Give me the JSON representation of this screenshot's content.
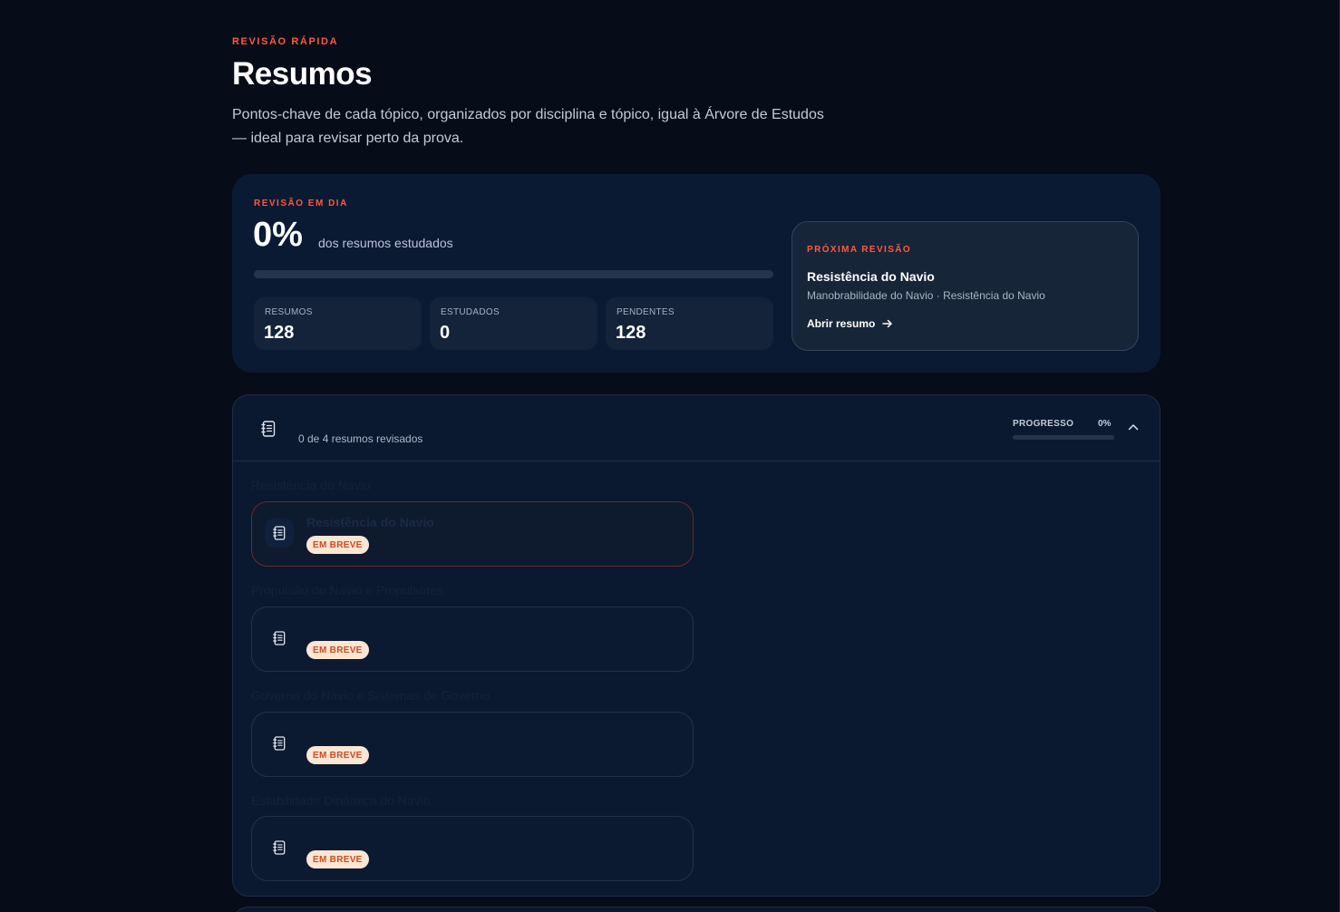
{
  "header": {
    "eyebrow": "REVISÃO RÁPIDA",
    "title": "Resumos",
    "description": "Pontos-chave de cada tópico, organizados por disciplina e tópico, igual à Árvore de Estudos — ideal para revisar perto da prova."
  },
  "summary": {
    "eyebrow": "REVISÃO EM DIA",
    "percent": "0%",
    "percent_label": "dos resumos estudados",
    "progress_fraction": 0,
    "stats": [
      {
        "label": "RESUMOS",
        "value": "128"
      },
      {
        "label": "ESTUDADOS",
        "value": "0"
      },
      {
        "label": "PENDENTES",
        "value": "128"
      }
    ],
    "next": {
      "eyebrow": "PRÓXIMA REVISÃO",
      "title": "Resistência do Navio",
      "path": "Manobrabilidade do Navio · Resistência do Navio",
      "link_label": "Abrir resumo"
    }
  },
  "discipline": {
    "subtitle": "0 de 4 resumos revisados",
    "progress_label": "PROGRESSO",
    "progress_value": "0%",
    "progress_fraction": 0,
    "topics": [
      {
        "label": "Resistência do Navio",
        "item_title": "Resistência do Navio",
        "badge": "EM BREVE",
        "active": true
      },
      {
        "label": "Propulsão do Navio e Propulsores",
        "item_title": "",
        "badge": "EM BREVE",
        "active": false
      },
      {
        "label": "Governo do Navio e Sistemas de Governo",
        "item_title": "",
        "badge": "EM BREVE",
        "active": false
      },
      {
        "label": "Estabilidade Dinâmica do Navio",
        "item_title": "",
        "badge": "EM BREVE",
        "active": false
      }
    ]
  },
  "icons": {
    "notebook": "notebook-icon",
    "arrow": "arrow-right-icon",
    "chevron": "chevron-up-icon"
  },
  "colors": {
    "accent": "#ff5a3c",
    "background": "#060c18",
    "card": "#0b1a33",
    "badge_bg": "#fde6d4",
    "badge_text": "#d44a1f"
  }
}
